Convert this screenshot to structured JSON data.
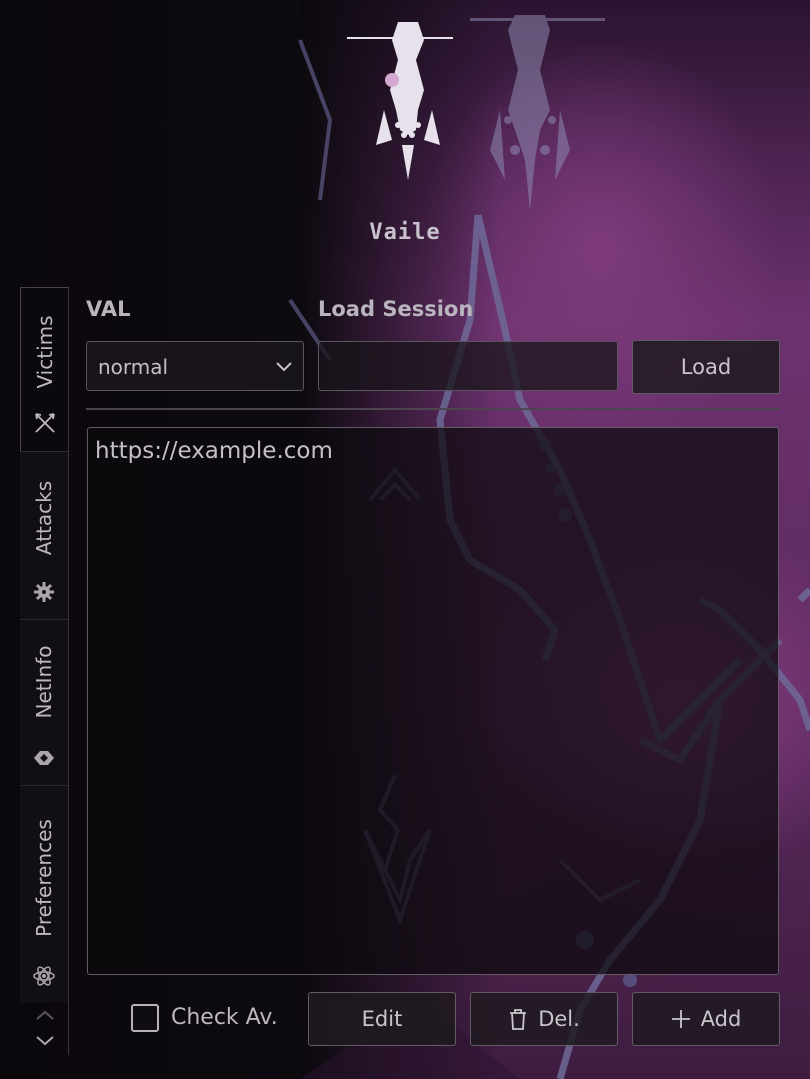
{
  "app": {
    "logo_text": "Vaile"
  },
  "tabs": [
    {
      "label": "Victims",
      "icon": "crossed-swords-icon",
      "active": true
    },
    {
      "label": "Attacks",
      "icon": "gear-icon",
      "active": false
    },
    {
      "label": "NetInfo",
      "icon": "shield-icon",
      "active": false
    },
    {
      "label": "Preferences",
      "icon": "atom-icon",
      "active": false
    }
  ],
  "panel": {
    "val_label": "VAL",
    "val_selected": "normal",
    "load_session_label": "Load Session",
    "load_session_value": "",
    "load_button": "Load",
    "targets_text": "https://example.com",
    "check_label": "Check Av.",
    "check_checked": false,
    "edit_button": "Edit",
    "delete_button": "Del.",
    "add_button": "Add"
  },
  "colors": {
    "background": "#0a080c",
    "accent_purple": "#7e3b7c",
    "text": "#c4bfc8"
  }
}
